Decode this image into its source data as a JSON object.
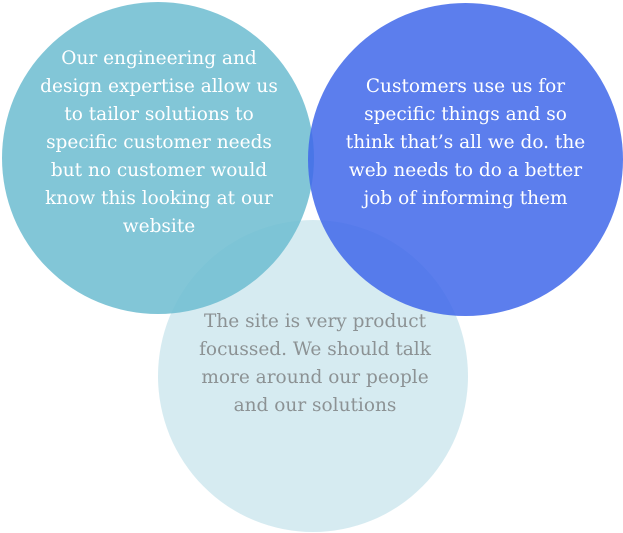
{
  "diagram": {
    "circles": [
      {
        "id": "engineering-expertise",
        "text": "Our engineering and design expertise allow us to tailor solutions to specific customer needs but no customer would know this looking at our website",
        "color": "#71bed1"
      },
      {
        "id": "customers-perception",
        "text": "Customers use us for specific things and so think that’s all we do. the web needs to do a better job of informing them",
        "color": "#4067ea"
      },
      {
        "id": "product-focus",
        "text": "The site is very product focussed. We should talk more around our people and our solutions",
        "color": "#b4dbe6"
      }
    ]
  }
}
